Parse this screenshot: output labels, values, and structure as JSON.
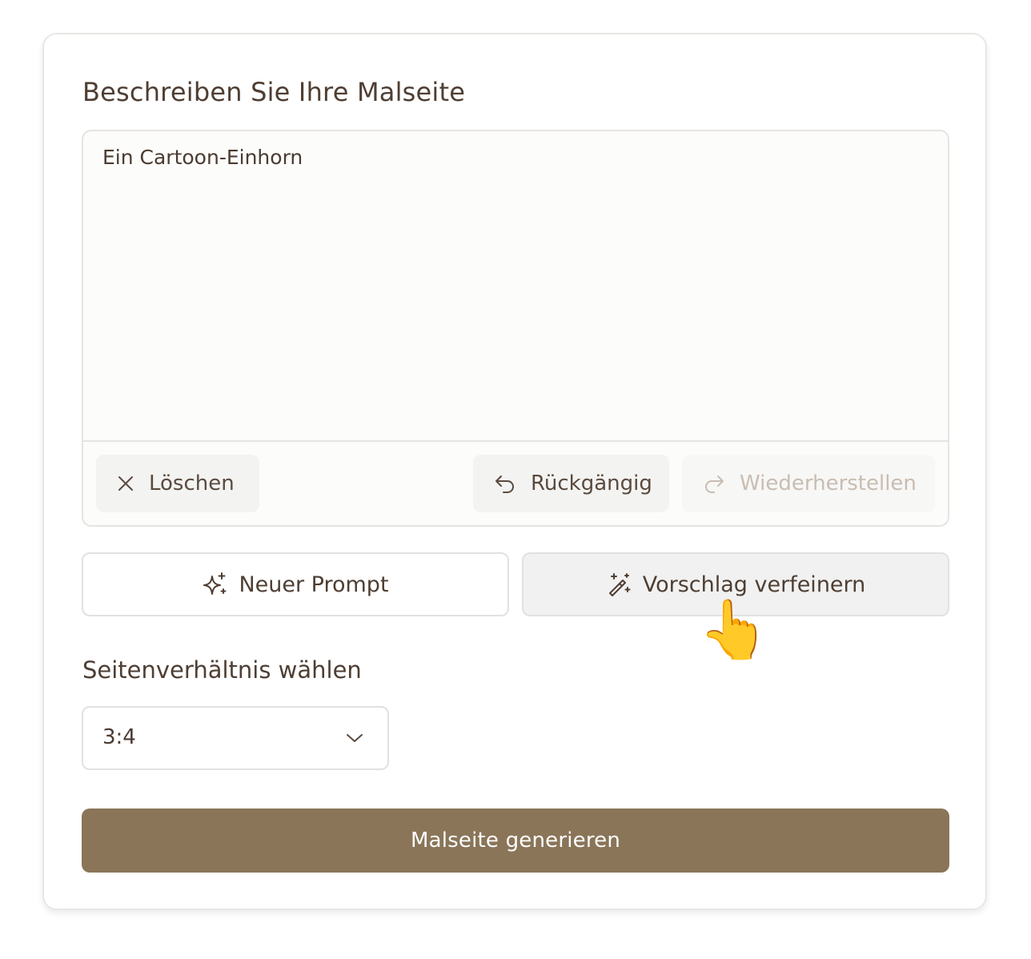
{
  "form": {
    "heading": "Beschreiben Sie Ihre Malseite",
    "prompt_value": "Ein Cartoon-Einhorn",
    "toolbar": {
      "clear_label": "Löschen",
      "undo_label": "Rückgängig",
      "redo_label": "Wiederherstellen",
      "redo_disabled": true
    },
    "actions": {
      "new_prompt_label": "Neuer Prompt",
      "refine_label": "Vorschlag verfeinern"
    },
    "ratio": {
      "label": "Seitenverhältnis wählen",
      "selected": "3:4"
    },
    "generate_label": "Malseite generieren"
  },
  "colors": {
    "primary": "#8a7559",
    "text": "#4e3e33",
    "disabled_text": "#c8bdb2",
    "border": "#e3e1de"
  },
  "icons": [
    "close-icon",
    "undo-icon",
    "redo-icon",
    "sparkles-icon",
    "magic-wand-icon",
    "chevron-down-icon",
    "pointing-hand-icon"
  ]
}
